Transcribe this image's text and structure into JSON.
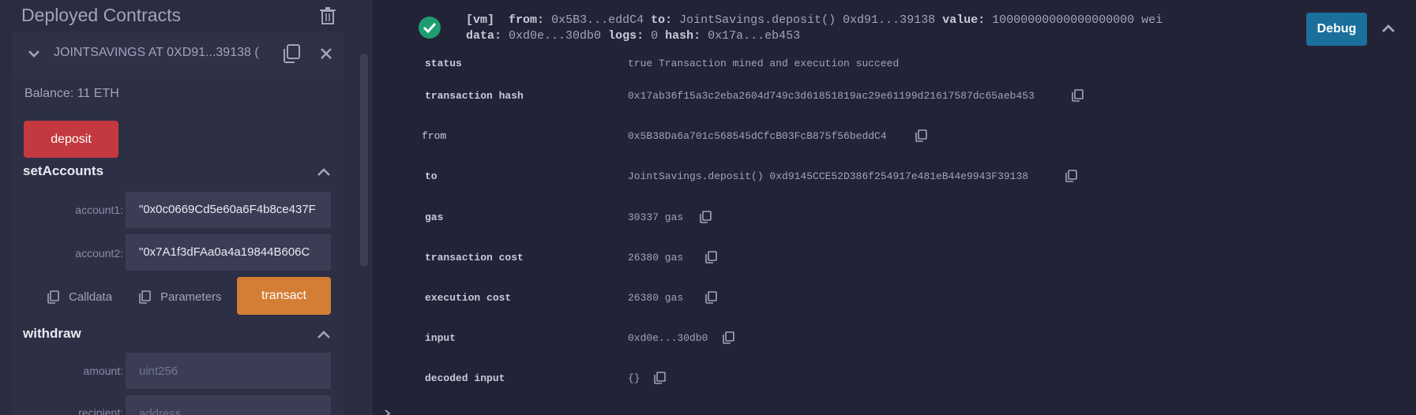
{
  "left_panel": {
    "title": "Deployed Contracts",
    "contract": {
      "name": "JOINTSAVINGS AT 0XD91...39138 (",
      "balance": "Balance: 11 ETH"
    },
    "deposit_label": "deposit",
    "set_accounts": {
      "title": "setAccounts",
      "fields": [
        {
          "label": "account1:",
          "value": "\"0x0c0669Cd5e60a6F4b8ce437F"
        },
        {
          "label": "account2:",
          "value": "\"0x7A1f3dFAa0a4a19844B606C"
        }
      ],
      "calldata_label": "Calldata",
      "parameters_label": "Parameters",
      "transact_label": "transact"
    },
    "withdraw": {
      "title": "withdraw",
      "fields": [
        {
          "label": "amount:",
          "placeholder": "uint256"
        },
        {
          "label": "recipient:",
          "placeholder": "address"
        }
      ]
    }
  },
  "transaction": {
    "summary_line1": {
      "tag": "[vm]",
      "from_key": "from:",
      "from_val": "0x5B3...eddC4",
      "to_key": "to:",
      "to_val": "JointSavings.deposit() 0xd91...39138",
      "value_key": "value:",
      "value_val": "10000000000000000000 wei"
    },
    "summary_line2": {
      "data_key": "data:",
      "data_val": "0xd0e...30db0",
      "logs_key": "logs:",
      "logs_val": "0",
      "hash_key": "hash:",
      "hash_val": "0x17a...eb453"
    },
    "debug_label": "Debug",
    "rows": [
      {
        "key": "status",
        "value": "true Transaction mined and execution succeed"
      },
      {
        "key": "transaction hash",
        "value": "0x17ab36f15a3c2eba2604d749c3d61851819ac29e61199d21617587dc65aeb453"
      },
      {
        "key": "from",
        "value": "0x5B38Da6a701c568545dCfcB03FcB875f56beddC4"
      },
      {
        "key": "to",
        "value": "JointSavings.deposit() 0xd9145CCE52D386f254917e481eB44e9943F39138"
      },
      {
        "key": "gas",
        "value": "30337 gas"
      },
      {
        "key": "transaction cost",
        "value": "26380 gas"
      },
      {
        "key": "execution cost",
        "value": "26380 gas"
      },
      {
        "key": "input",
        "value": "0xd0e...30db0"
      },
      {
        "key": "decoded input",
        "value": "{}"
      }
    ]
  },
  "colors": {
    "panel_bg": "#2a2c3f",
    "main_bg": "#222336",
    "deposit_red": "#c4393f",
    "transact_orange": "#d47d35",
    "debug_blue": "#1b6f9b",
    "success_green": "#1f9d71"
  },
  "icons": [
    "trash-icon",
    "chevron-down-icon",
    "copy-icon",
    "close-icon",
    "chevron-up-icon",
    "check-circle-icon"
  ]
}
